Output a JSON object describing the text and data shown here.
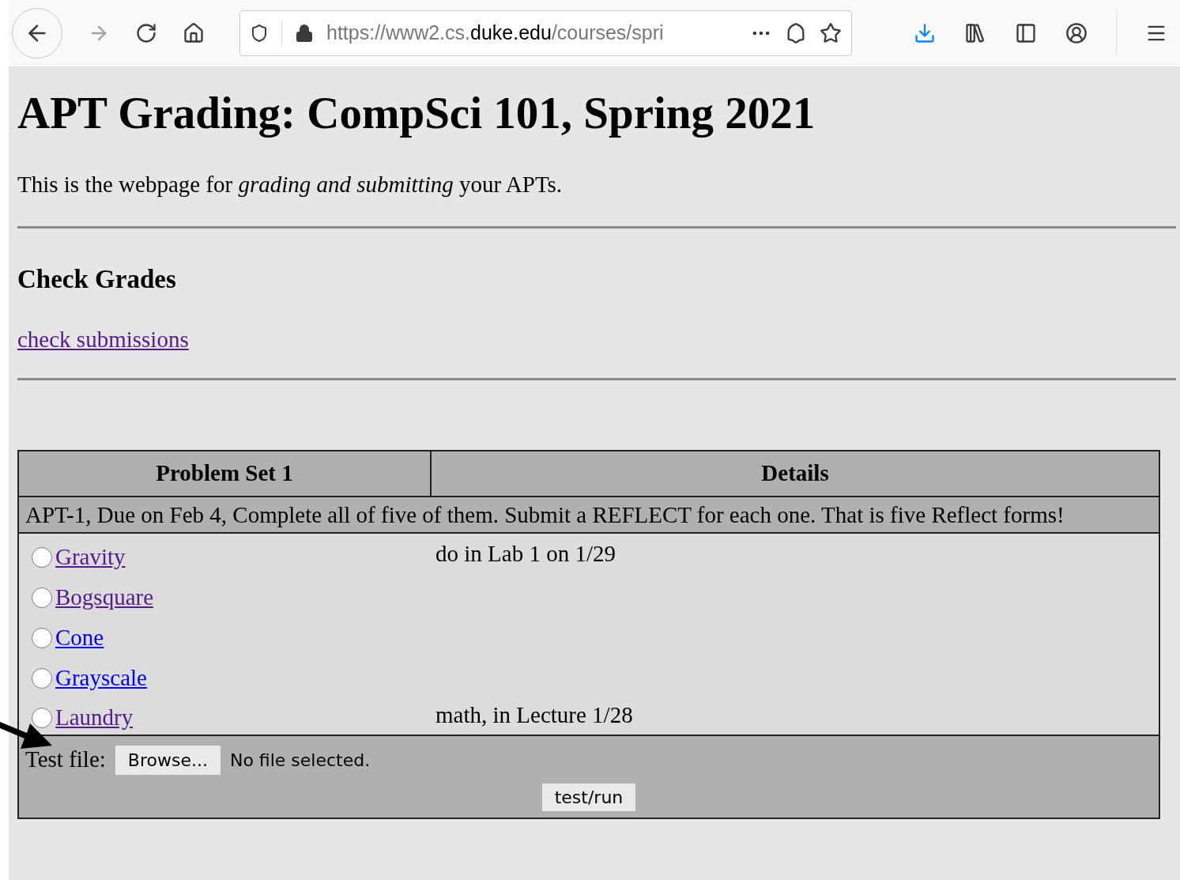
{
  "browser": {
    "url": {
      "prefix": "https://www2.cs.",
      "domain": "duke.edu",
      "suffix": "/courses/spri"
    }
  },
  "page": {
    "title": "APT Grading: CompSci 101, Spring 2021",
    "intro": "This is the webpage for *grading and submitting* your APTs.",
    "section_title": "Check Grades",
    "section_link": "check submissions"
  },
  "table": {
    "columns": [
      "Problem Set 1",
      "Details"
    ],
    "description": "APT-1, Due on Feb 4, Complete all of five of them. Submit a REFLECT for each one. That is five Reflect forms!",
    "rows": [
      {
        "name": "Gravity",
        "visited": true,
        "selected": false,
        "details": "do in Lab 1 on 1/29"
      },
      {
        "name": "Bogsquare",
        "visited": true,
        "selected": false
      },
      {
        "name": "Cone",
        "visited": false,
        "selected": false
      },
      {
        "name": "Grayscale",
        "visited": false,
        "selected": false
      },
      {
        "name": "Laundry",
        "visited": true,
        "selected": false,
        "details": "math, in Lecture 1/28"
      }
    ],
    "test_file_label": "Test file:",
    "browse_button": "Browse...",
    "file_status": "No file selected.",
    "run_button": "test/run"
  }
}
